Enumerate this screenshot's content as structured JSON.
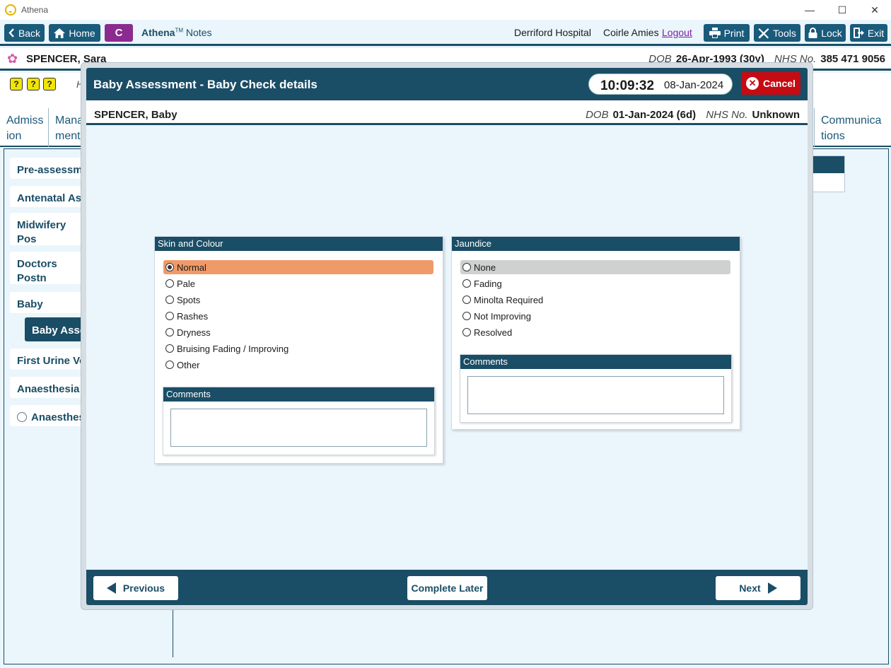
{
  "window": {
    "title": "Athena",
    "controls": [
      "—",
      "☐",
      "✕"
    ]
  },
  "toolbar": {
    "back_label": "Back",
    "home_label": "Home",
    "c_label": "C",
    "brand_name": "Athena",
    "brand_tm": "TM",
    "brand_suffix": "Notes",
    "hospital": "Derriford Hospital",
    "user": "Coirle Amies",
    "logout_label": "Logout",
    "print_label": "Print",
    "tools_label": "Tools",
    "lock_label": "Lock",
    "exit_label": "Exit"
  },
  "patient": {
    "name": "SPENCER, Sara",
    "dob_label": "DOB",
    "dob": "26-Apr-1993 (30y)",
    "nhs_label": "NHS No.",
    "nhs": "385 471 9056"
  },
  "icon_strip": {
    "icons": [
      "?",
      "?",
      "?"
    ],
    "text": "H"
  },
  "tabs": [
    {
      "label": "Admiss ion"
    },
    {
      "label": "Mana ment"
    },
    {
      "label": "Communica tions"
    }
  ],
  "sidebar": {
    "items": [
      {
        "label": "Pre-assessmen"
      },
      {
        "label": "Antenatal Ass"
      },
      {
        "label": "Midwifery Pos Assessments"
      },
      {
        "label": "Doctors Postn Assessments"
      },
      {
        "label": "Baby"
      },
      {
        "label": "Baby Assess"
      },
      {
        "label": "First Urine Voi"
      },
      {
        "label": "Anaesthesia In"
      },
      {
        "label": "Anaesthesia"
      }
    ]
  },
  "modal": {
    "title": "Baby Assessment - Baby Check details",
    "time": "10:09:32",
    "date": "08-Jan-2024",
    "cancel_label": "Cancel",
    "baby": {
      "name": "SPENCER, Baby",
      "dob_label": "DOB",
      "dob": "01-Jan-2024 (6d)",
      "nhs_label": "NHS No.",
      "nhs": "Unknown"
    },
    "skin": {
      "title": "Skin and Colour",
      "options": [
        "Normal",
        "Pale",
        "Spots",
        "Rashes",
        "Dryness",
        "Bruising Fading / Improving",
        "Other"
      ],
      "selected": "Normal",
      "comments_label": "Comments",
      "comments_value": ""
    },
    "jaundice": {
      "title": "Jaundice",
      "options": [
        "None",
        "Fading",
        "Minolta Required",
        "Not Improving",
        "Resolved"
      ],
      "hovered": "None",
      "comments_label": "Comments",
      "comments_value": ""
    },
    "footer": {
      "previous_label": "Previous",
      "complete_later_label": "Complete Later",
      "next_label": "Next"
    }
  },
  "colors": {
    "primary": "#1a4d66",
    "selected_option": "#f19a69",
    "hover_option": "#cfd0d0",
    "cancel": "#c60b13",
    "c_button": "#8b2b8f",
    "background": "#eaf5fc"
  }
}
